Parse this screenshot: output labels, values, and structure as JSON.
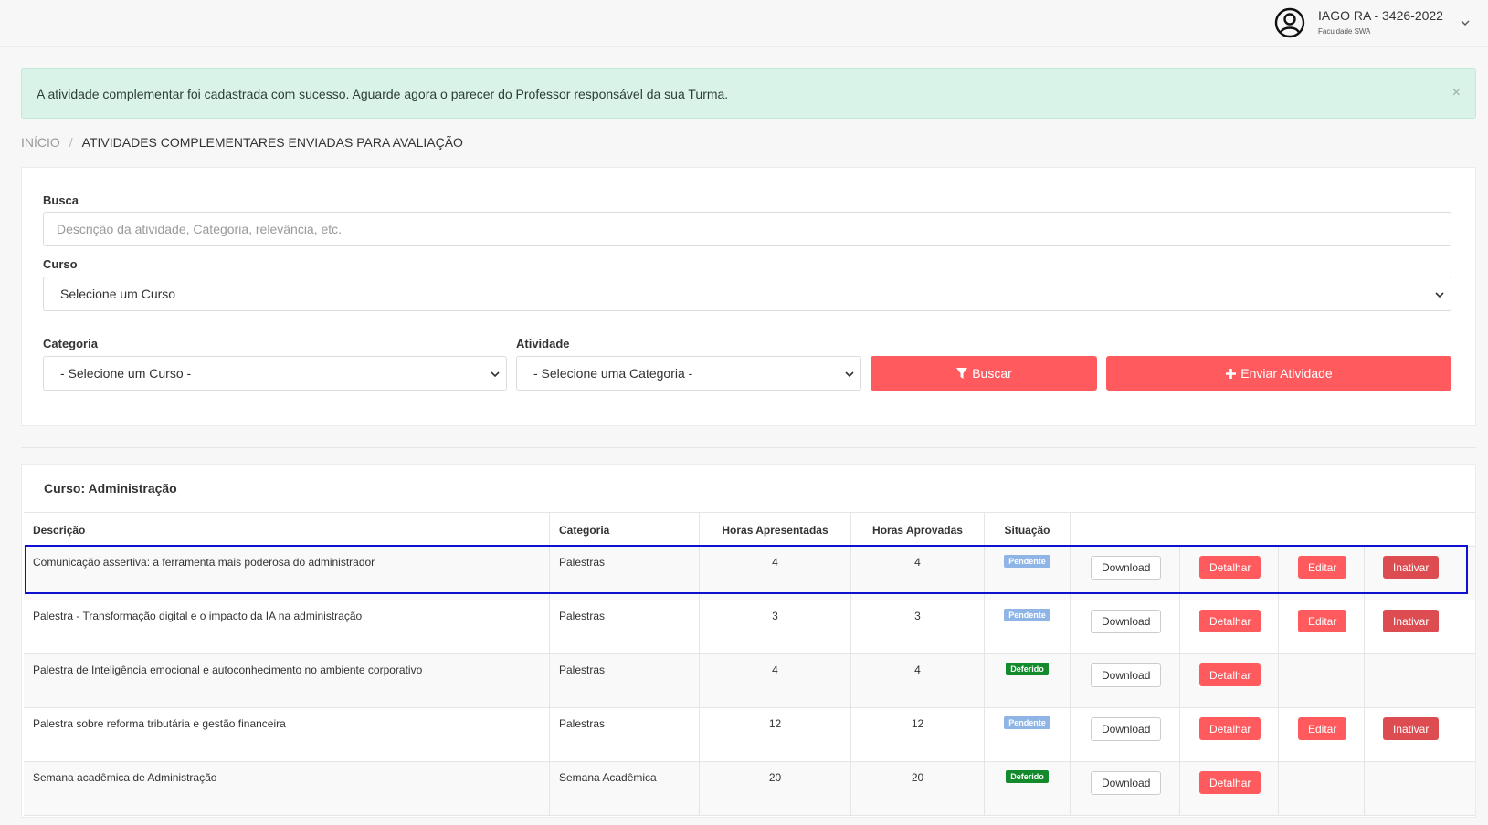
{
  "user": {
    "name": "IAGO RA - 3426-2022",
    "institution": "Faculdade SWA"
  },
  "alert": {
    "message": "A atividade complementar foi cadastrada com sucesso. Aguarde agora o parecer do Professor responsável da sua Turma.",
    "close": "×"
  },
  "breadcrumb": {
    "home": "INÍCIO",
    "separator": "/",
    "current": "ATIVIDADES COMPLEMENTARES ENVIADAS PARA AVALIAÇÃO"
  },
  "filters": {
    "search_label": "Busca",
    "search_placeholder": "Descrição da atividade, Categoria, relevância, etc.",
    "course_label": "Curso",
    "course_value": "Selecione um Curso",
    "category_label": "Categoria",
    "category_value": "- Selecione um Curso -",
    "activity_label": "Atividade",
    "activity_value": "- Selecione uma Categoria -",
    "search_button": "Buscar",
    "send_button": "Enviar Atividade"
  },
  "table": {
    "course_title": "Curso: Administração",
    "headers": {
      "description": "Descrição",
      "category": "Categoria",
      "hours_presented": "Horas Apresentadas",
      "hours_approved": "Horas Aprovadas",
      "status": "Situação"
    },
    "buttons": {
      "download": "Download",
      "details": "Detalhar",
      "edit": "Editar",
      "deactivate": "Inativar"
    },
    "rows": [
      {
        "description": "Comunicação assertiva: a ferramenta mais poderosa do administrador",
        "category": "Palestras",
        "hours_presented": "4",
        "hours_approved": "4",
        "status": "Pendente"
      },
      {
        "description": "Palestra - Transformação digital e o impacto da IA na administração",
        "category": "Palestras",
        "hours_presented": "3",
        "hours_approved": "3",
        "status": "Pendente"
      },
      {
        "description": "Palestra de Inteligência emocional e autoconhecimento no ambiente corporativo",
        "category": "Palestras",
        "hours_presented": "4",
        "hours_approved": "4",
        "status": "Deferido"
      },
      {
        "description": "Palestra sobre reforma tributária e gestão financeira",
        "category": "Palestras",
        "hours_presented": "12",
        "hours_approved": "12",
        "status": "Pendente"
      },
      {
        "description": "Semana acadêmica de Administração",
        "category": "Semana Acadêmica",
        "hours_presented": "20",
        "hours_approved": "20",
        "status": "Deferido"
      }
    ]
  },
  "colors": {
    "primary_red": "#ff5b5f",
    "alert_bg": "#d9f3e9",
    "badge_pending": "#8fb4e6",
    "badge_approved": "#138a2c",
    "highlight_border": "#1010d0"
  },
  "icons": {
    "avatar": "user-circle-icon",
    "user_menu": "chevron-down-icon",
    "search_button": "filter-icon",
    "send_button": "plus-icon"
  }
}
